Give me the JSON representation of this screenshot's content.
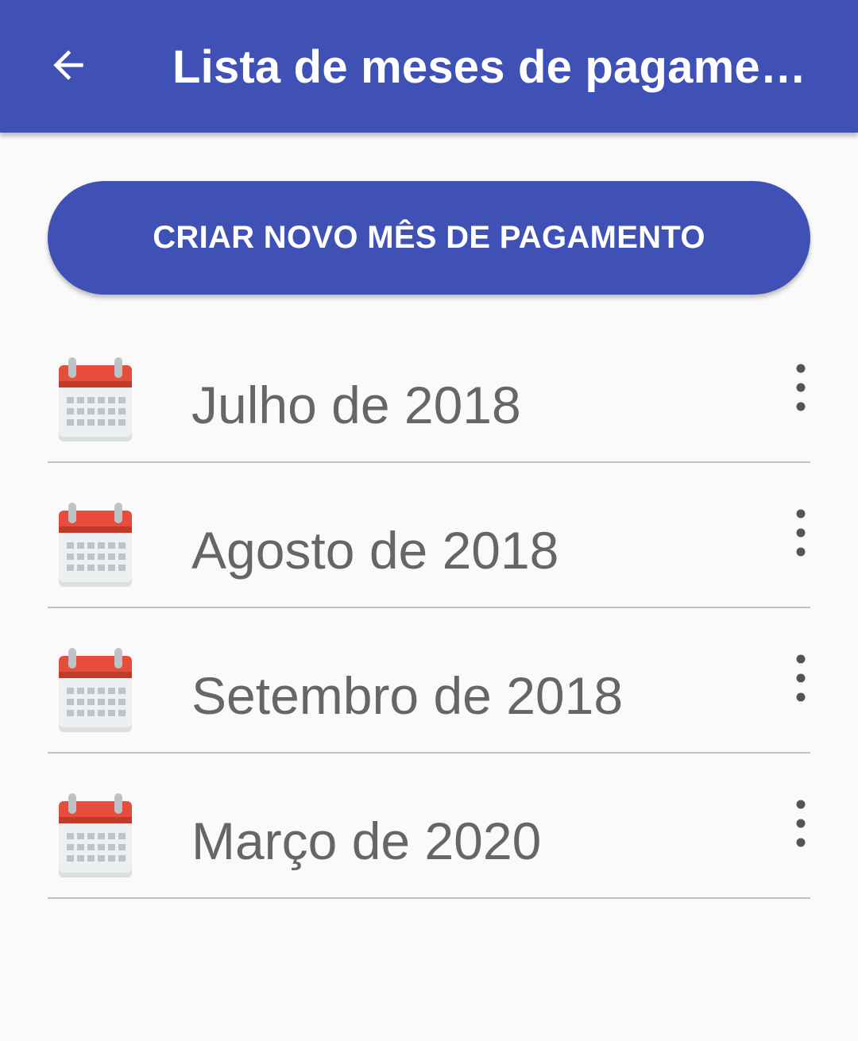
{
  "app_bar": {
    "title": "Lista de meses de pagamen…",
    "back_icon": "arrow-back-icon",
    "background_color": "#3f51b5"
  },
  "create_button": {
    "label": "CRIAR NOVO MÊS DE PAGAMENTO",
    "background_color": "#3f51b5"
  },
  "months": [
    {
      "label": "Julho de 2018",
      "icon": "calendar-icon",
      "menu_icon": "more-vert-icon"
    },
    {
      "label": "Agosto de 2018",
      "icon": "calendar-icon",
      "menu_icon": "more-vert-icon"
    },
    {
      "label": "Setembro de 2018",
      "icon": "calendar-icon",
      "menu_icon": "more-vert-icon"
    },
    {
      "label": "Março de 2020",
      "icon": "calendar-icon",
      "menu_icon": "more-vert-icon"
    }
  ],
  "colors": {
    "primary": "#3f51b5",
    "calendar_header": "#e84c3d",
    "text_secondary": "#666666",
    "divider": "#c4c4c4"
  }
}
